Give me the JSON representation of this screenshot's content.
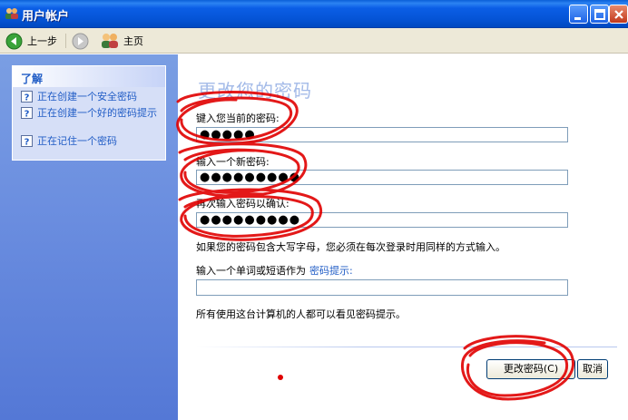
{
  "window": {
    "title": "用户帐户"
  },
  "toolbar": {
    "back_label": "上一步",
    "home_label": "主页"
  },
  "learn": {
    "header": "了解",
    "links": [
      "正在创建一个安全密码",
      "正在创建一个好的密码提示",
      "正在记住一个密码"
    ]
  },
  "main": {
    "title": "更改您的密码",
    "current_label": "键入您当前的密码:",
    "current_value": "●●●●●",
    "new_label": "输入一个新密码:",
    "new_value": "●●●●●●●●●",
    "confirm_label": "再次输入密码以确认:",
    "confirm_value": "●●●●●●●●●",
    "case_note": "如果您的密码包含大写字母，您必须在每次登录时用同样的方式输入。",
    "hint_label": "输入一个单词或短语作为",
    "hint_link": "密码提示:",
    "hint_value": "",
    "visible_note": "所有使用这台计算机的人都可以看见密码提示。",
    "change_button": "更改密码(C)",
    "cancel_button": "取消"
  },
  "colors": {
    "title_bar": "#0554d6",
    "left_panel": "#6c8fe0",
    "link": "#215dc6",
    "page_title": "#a3bae8",
    "annotation": "#e00000"
  }
}
